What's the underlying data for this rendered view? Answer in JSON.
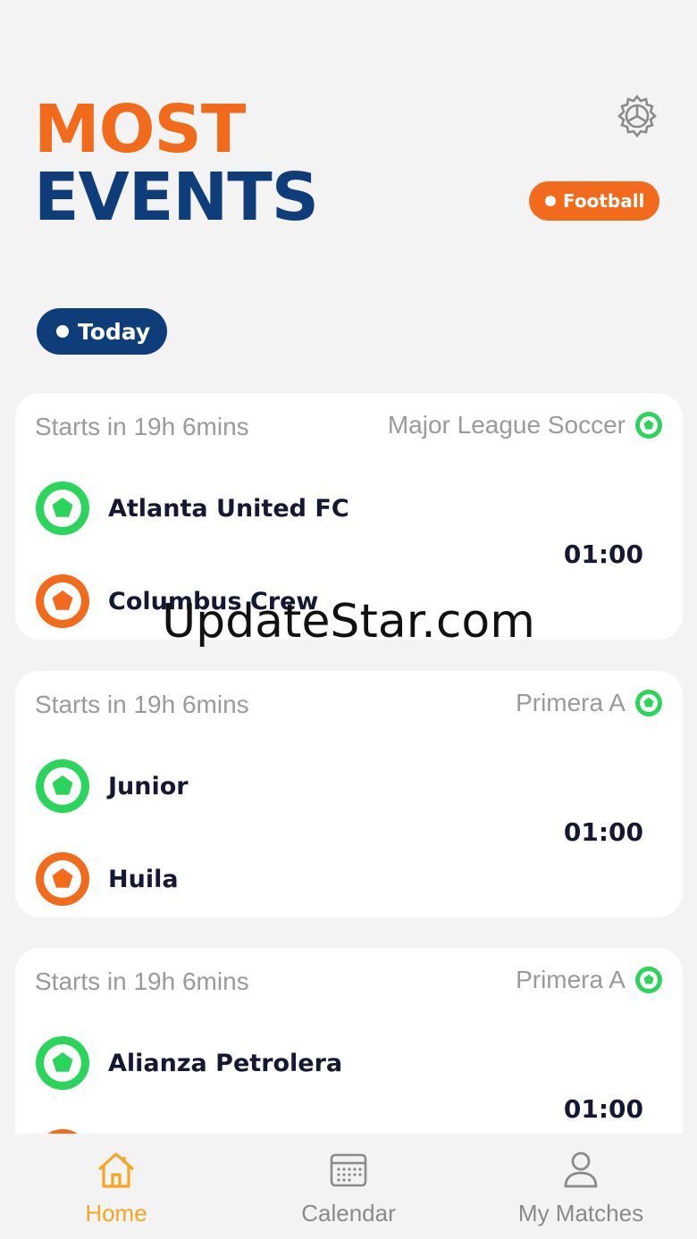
{
  "header": {
    "title_line1": "MOST",
    "title_line2": "EVENTS",
    "settings_icon": "gear-icon",
    "sport_filter": "Football",
    "date_filter": "Today"
  },
  "colors": {
    "accent_orange": "#f26a1b",
    "accent_navy": "#0f3d7a",
    "home_green": "#2bd45a",
    "active_tab": "#f5a623"
  },
  "matches": [
    {
      "starts": "Starts in 19h 6mins",
      "league": "Major League Soccer",
      "home": "Atlanta United FC",
      "away": "Columbus Crew",
      "time": "01:00"
    },
    {
      "starts": "Starts in 19h 6mins",
      "league": "Primera A",
      "home": "Junior",
      "away": "Huila",
      "time": "01:00"
    },
    {
      "starts": "Starts in 19h 6mins",
      "league": "Primera A",
      "home": "Alianza Petrolera",
      "away": "",
      "time": "01:00"
    }
  ],
  "watermark": "UpdateStar.com",
  "tabs": [
    {
      "label": "Home",
      "icon": "home-icon"
    },
    {
      "label": "Calendar",
      "icon": "calendar-icon"
    },
    {
      "label": "My Matches",
      "icon": "user-icon"
    }
  ]
}
